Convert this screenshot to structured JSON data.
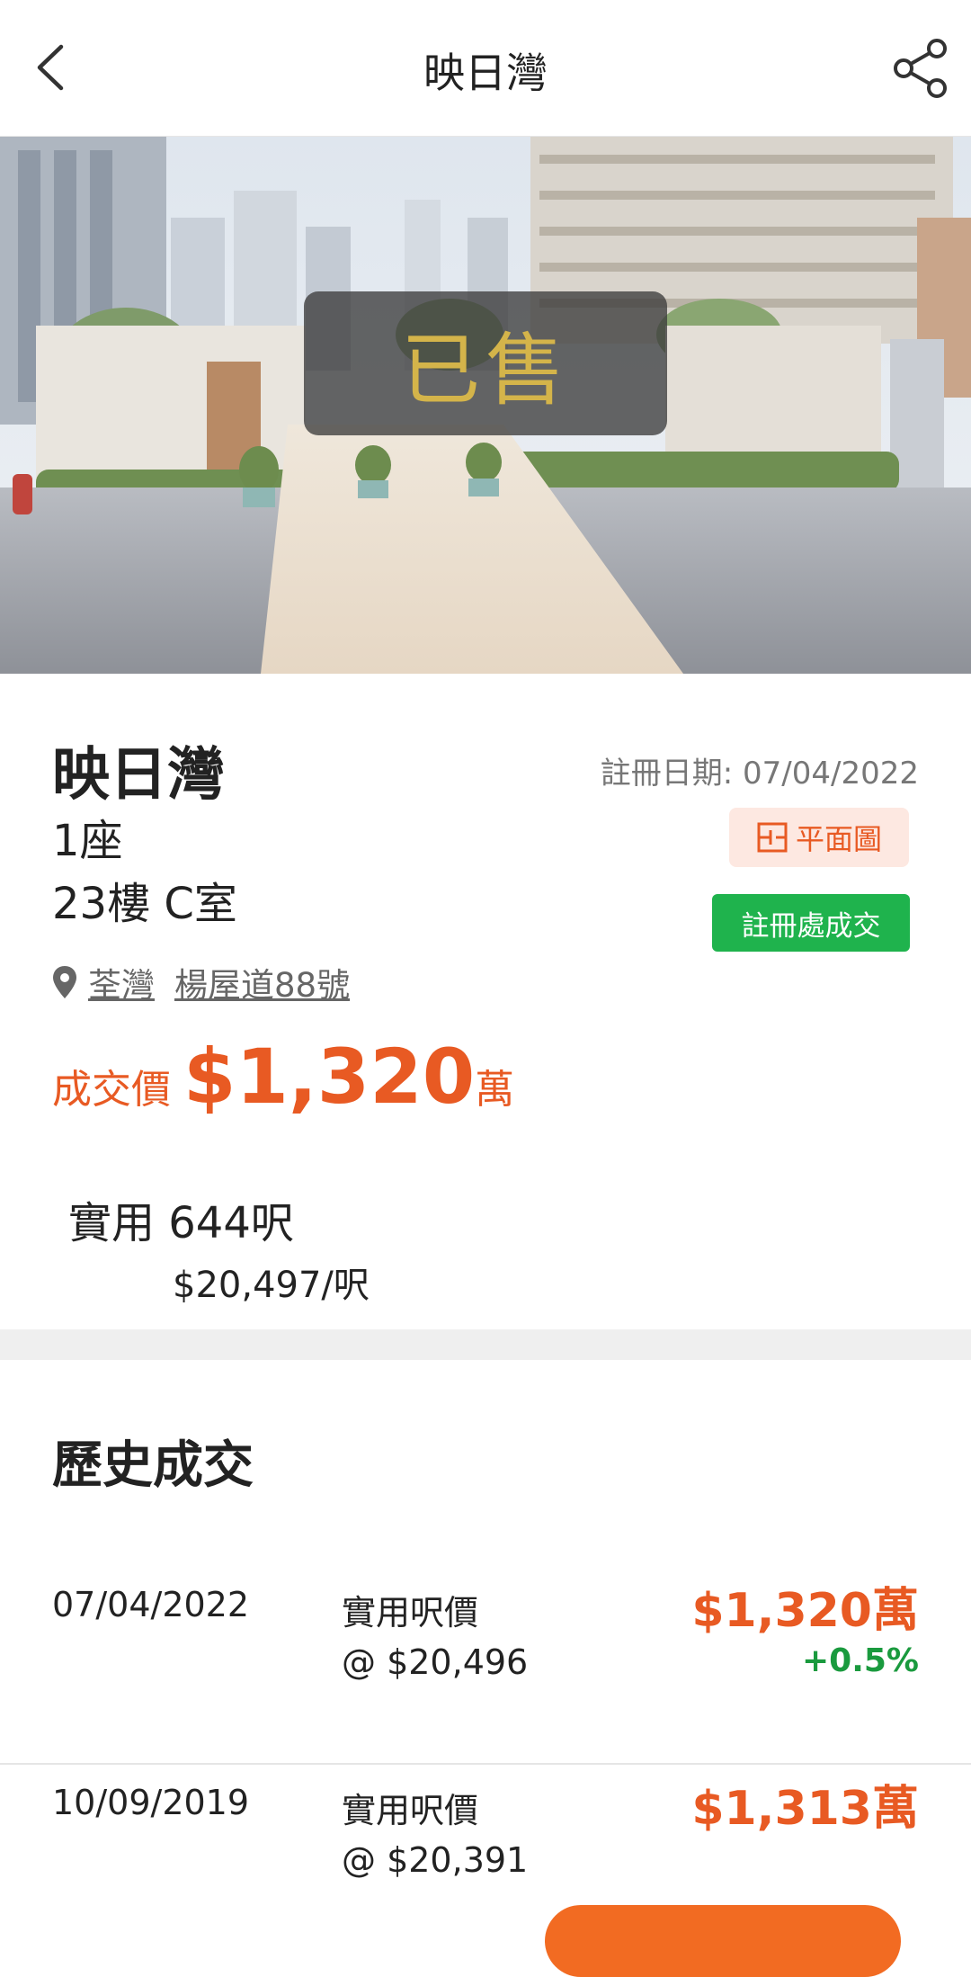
{
  "header": {
    "title": "映日灣",
    "back_icon": "chevron-left-icon",
    "share_icon": "share-icon"
  },
  "hero": {
    "sold_label": "已售"
  },
  "listing": {
    "name": "映日灣",
    "block": "1座",
    "unit": "23樓 C室",
    "registration_date": "註冊日期: 07/04/2022",
    "floorplan_button": "平面圖",
    "registry_button": "註冊處成交",
    "district": "荃灣",
    "street": "楊屋道88號",
    "price_label": "成交價",
    "price_value": "$1,320",
    "price_unit": "萬",
    "saleable_area": "實用 644呎",
    "price_per_sqft": "$20,497/呎"
  },
  "history": {
    "title": "歷史成交",
    "transactions": [
      {
        "date": "07/04/2022",
        "label": "實用呎價",
        "psf": "@ $20,496",
        "price": "$1,320萬",
        "change": "+0.5%"
      },
      {
        "date": "10/09/2019",
        "label": "實用呎價",
        "psf": "@ $20,391",
        "price": "$1,313萬",
        "change": ""
      }
    ]
  },
  "colors": {
    "accent_orange": "#e85a23",
    "green": "#1fb34d",
    "positive_change": "#1a9a3e",
    "sold_text": "#d4b44a"
  }
}
